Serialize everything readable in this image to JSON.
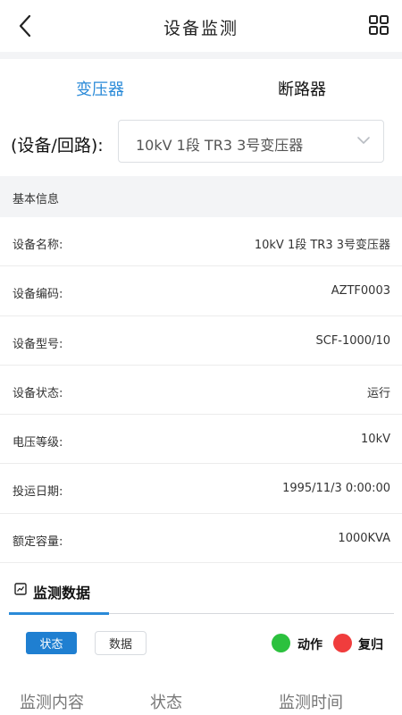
{
  "header": {
    "title": "设备监测",
    "back_icon": "chevron-left-icon",
    "grid_icon": "grid-icon"
  },
  "tabs": [
    {
      "label": "变压器",
      "active": true
    },
    {
      "label": "断路器",
      "active": false
    }
  ],
  "selector": {
    "label": "(设备/回路):",
    "value": "10kV 1段 TR3 3号变压器"
  },
  "basic_info": {
    "title": "基本信息",
    "rows": [
      {
        "key": "设备名称:",
        "value": "10kV 1段 TR3 3号变压器"
      },
      {
        "key": "设备编码:",
        "value": "AZTF0003"
      },
      {
        "key": "设备型号:",
        "value": "SCF-1000/10"
      },
      {
        "key": "设备状态:",
        "value": "运行"
      },
      {
        "key": "电压等级:",
        "value": "10kV"
      },
      {
        "key": "投运日期:",
        "value": "1995/11/3 0:00:00"
      },
      {
        "key": "额定容量:",
        "value": "1000KVA"
      }
    ]
  },
  "monitor": {
    "title": "监测数据",
    "btn_state": "状态",
    "btn_data": "数据",
    "legend_act": "动作",
    "legend_reset": "复归",
    "colors": {
      "act": "#2cc13e",
      "reset": "#f03d3d",
      "accent": "#1f7fd1"
    },
    "columns": [
      "监测内容",
      "状态",
      "监测时间"
    ]
  }
}
